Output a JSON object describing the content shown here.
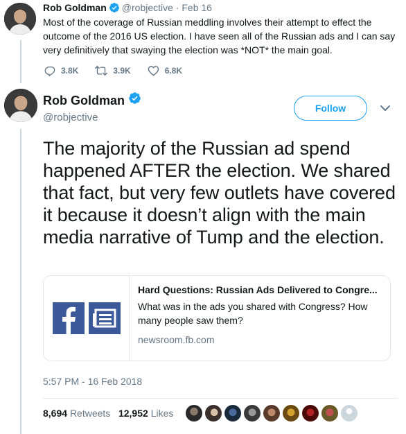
{
  "first_tweet": {
    "name": "Rob Goldman",
    "handle": "@robjective",
    "separator": "·",
    "date": "Feb 16",
    "text": "Most of the coverage of Russian meddling involves their attempt to effect the outcome of the 2016 US election.  I have seen all of the Russian ads and I can say very definitively that swaying the election was *NOT* the main goal.",
    "replies": "3.8K",
    "retweets": "3.9K",
    "likes": "6.8K"
  },
  "main_tweet": {
    "name": "Rob Goldman",
    "handle": "@robjective",
    "follow_label": "Follow",
    "text": "The majority of the Russian ad spend happened AFTER the election.  We shared that fact, but very few outlets have covered it because it doesn’t align with the main media narrative of Tump and the election.",
    "card": {
      "title": "Hard Questions: Russian Ads Delivered to Congre...",
      "description": "What was in the ads you shared with Congress? How many people saw them?",
      "domain": "newsroom.fb.com"
    },
    "timestamp": "5:57 PM - 16 Feb 2018",
    "retweet_count": "8,694",
    "retweet_label": "Retweets",
    "like_count": "12,952",
    "like_label": "Likes"
  },
  "colors": {
    "accent": "#1da1f2",
    "secondary_text": "#657786",
    "facebook_blue": "#3b5998"
  },
  "icons": [
    "verified-icon",
    "reply-icon",
    "retweet-icon",
    "like-icon",
    "chevron-down-icon",
    "facebook-logo",
    "newsroom-icon"
  ]
}
